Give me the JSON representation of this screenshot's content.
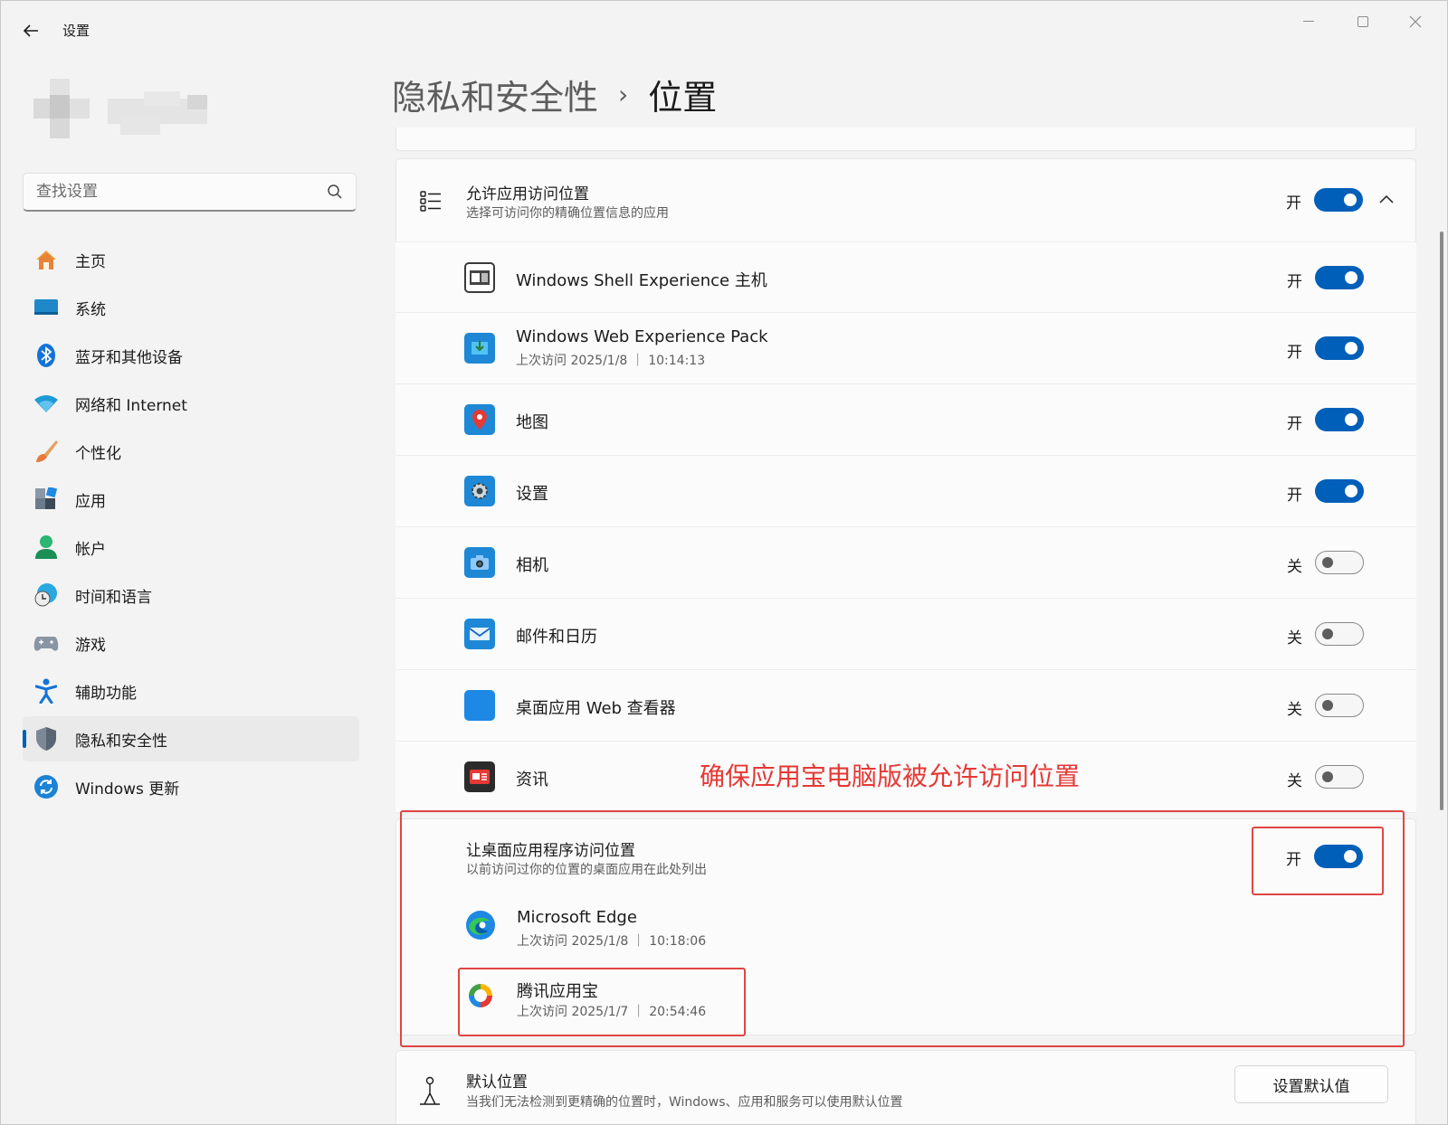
{
  "window": {
    "title": "设置",
    "controls": [
      "minimize",
      "maximize",
      "close"
    ]
  },
  "search": {
    "placeholder": "查找设置"
  },
  "sidebar": {
    "items": [
      {
        "label": "主页",
        "icon": "home-icon"
      },
      {
        "label": "系统",
        "icon": "system-icon"
      },
      {
        "label": "蓝牙和其他设备",
        "icon": "bluetooth-icon"
      },
      {
        "label": "网络和 Internet",
        "icon": "wifi-icon"
      },
      {
        "label": "个性化",
        "icon": "brush-icon"
      },
      {
        "label": "应用",
        "icon": "apps-icon"
      },
      {
        "label": "帐户",
        "icon": "account-icon"
      },
      {
        "label": "时间和语言",
        "icon": "time-language-icon"
      },
      {
        "label": "游戏",
        "icon": "gamepad-icon"
      },
      {
        "label": "辅助功能",
        "icon": "accessibility-icon"
      },
      {
        "label": "隐私和安全性",
        "icon": "shield-icon",
        "active": true
      },
      {
        "label": "Windows 更新",
        "icon": "update-icon"
      }
    ]
  },
  "heading": {
    "parent": "隐私和安全性",
    "separator": "›",
    "current": "位置"
  },
  "allow_apps": {
    "title": "允许应用访问位置",
    "subtitle": "选择可访问你的精确位置信息的应用",
    "state": "开",
    "on": true
  },
  "apps": [
    {
      "name": "Windows Shell Experience 主机",
      "sub": "",
      "state": "开",
      "on": true,
      "icon": "shell-experience-icon"
    },
    {
      "name": "Windows Web Experience Pack",
      "sub": "上次访问 2025/1/8 ｜ 10:14:13",
      "state": "开",
      "on": true,
      "icon": "web-experience-icon"
    },
    {
      "name": "地图",
      "sub": "",
      "state": "开",
      "on": true,
      "icon": "maps-icon"
    },
    {
      "name": "设置",
      "sub": "",
      "state": "开",
      "on": true,
      "icon": "settings-app-icon"
    },
    {
      "name": "相机",
      "sub": "",
      "state": "关",
      "on": false,
      "icon": "camera-icon"
    },
    {
      "name": "邮件和日历",
      "sub": "",
      "state": "关",
      "on": false,
      "icon": "mail-icon"
    },
    {
      "name": "桌面应用 Web 查看器",
      "sub": "",
      "state": "关",
      "on": false,
      "icon": "web-viewer-icon"
    },
    {
      "name": "资讯",
      "sub": "",
      "state": "关",
      "on": false,
      "icon": "news-icon"
    }
  ],
  "annotation": "确保应用宝电脑版被允许访问位置",
  "desktop_apps": {
    "title": "让桌面应用程序访问位置",
    "subtitle": "以前访问过你的位置的桌面应用在此处列出",
    "state": "开",
    "on": true,
    "items": [
      {
        "name": "Microsoft Edge",
        "sub": "上次访问 2025/1/8 ｜ 10:18:06",
        "icon": "edge-icon"
      },
      {
        "name": "腾讯应用宝",
        "sub": "上次访问 2025/1/7 ｜ 20:54:46",
        "icon": "tencent-appstore-icon"
      }
    ]
  },
  "default_location": {
    "title": "默认位置",
    "subtitle": "当我们无法检测到更精确的位置时，Windows、应用和服务可以使用默认位置",
    "button": "设置默认值"
  },
  "colors": {
    "accent": "#005fb8",
    "annotation": "#e53935"
  }
}
